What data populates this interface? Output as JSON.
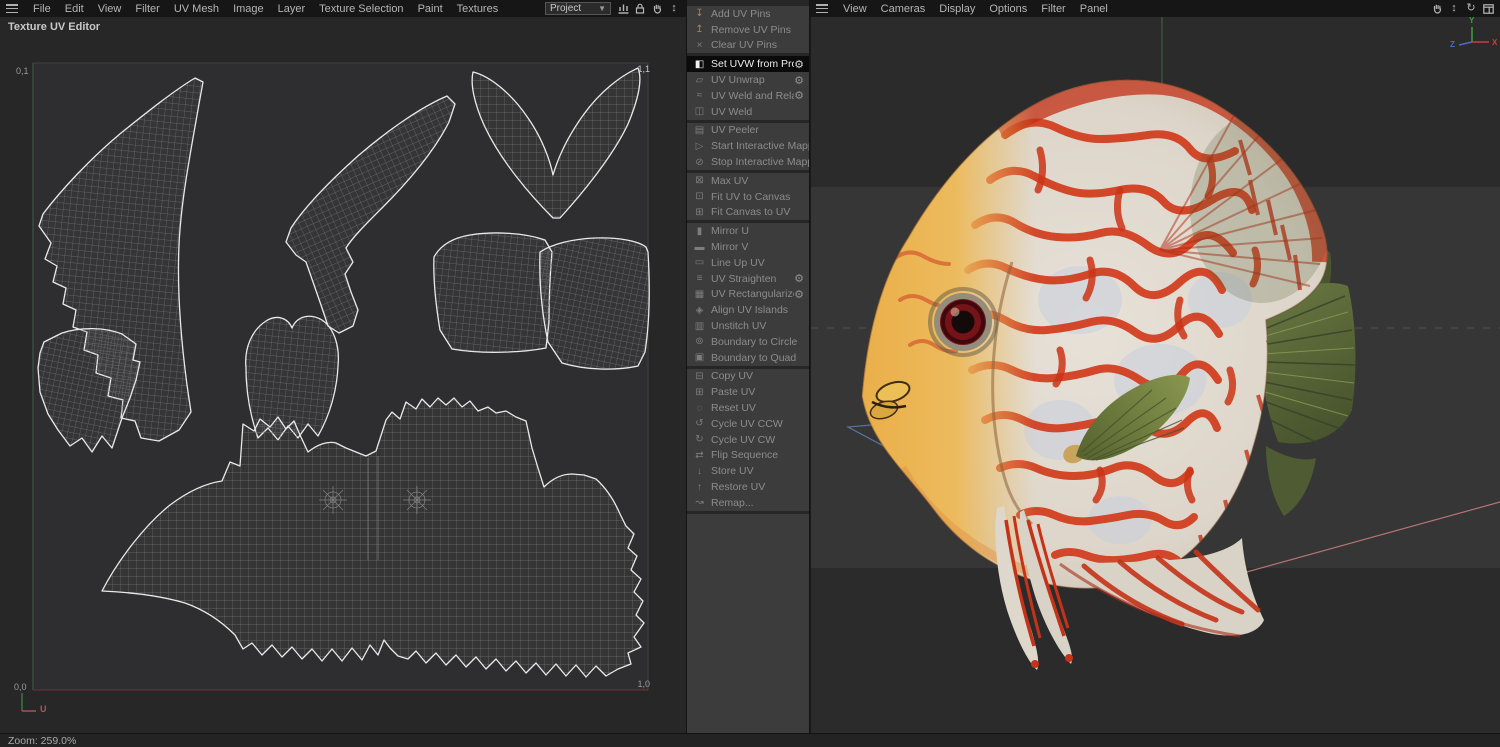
{
  "window": {
    "status_zoom": "Zoom: 259.0%"
  },
  "left_menubar": {
    "items": [
      "File",
      "Edit",
      "View",
      "Filter",
      "UV Mesh",
      "Image",
      "Layer",
      "Texture Selection",
      "Paint",
      "Textures"
    ],
    "project_dropdown": "Project",
    "icons": [
      "histogram-icon",
      "lock-icon",
      "hand-icon",
      "move-vertical-icon"
    ]
  },
  "right_menubar": {
    "items": [
      "View",
      "Cameras",
      "Display",
      "Options",
      "Filter",
      "Panel"
    ],
    "icons": [
      "hand-icon",
      "move-vertical-icon",
      "rotate-icon",
      "panel-icon"
    ]
  },
  "uv_editor": {
    "title": "Texture UV Editor",
    "corner_labels": {
      "top_left": "0,1",
      "top_right": "1,1",
      "bottom_left": "0,0",
      "bottom_right": "1,0"
    },
    "axis_u_label": "U"
  },
  "viewport_gizmo": {
    "x": "X",
    "y": "Y",
    "z": "Z"
  },
  "colors": {
    "axis_x_red": "#c04040",
    "axis_y_green": "#3aa43a",
    "axis_z_blue": "#4a6cc8",
    "uv_u_axis_red": "#b35555",
    "uv_v_axis_green": "#3d7a4d",
    "highlight_row_bg": "#0b0b0b",
    "fish_pattern_red": "#d23b1c",
    "fish_head_yellow": "#eaae48",
    "fin_olive_green": "#6a7a42"
  },
  "command_panel": {
    "gear_glyph": "⚙",
    "groups": [
      {
        "items": [
          {
            "label": "Add UV Pins",
            "glyph": "↧",
            "pin": true,
            "enabled": false
          },
          {
            "label": "Remove UV Pins",
            "glyph": "↥",
            "pin": true,
            "enabled": false
          },
          {
            "label": "Clear UV Pins",
            "glyph": "×",
            "enabled": false
          }
        ]
      },
      {
        "items": [
          {
            "label": "Set UVW from Projection",
            "glyph": "◧",
            "active": true,
            "gear": true,
            "enabled": true
          },
          {
            "label": "UV Unwrap",
            "glyph": "▱",
            "gear": true,
            "enabled": false
          },
          {
            "label": "UV Weld and Relax",
            "glyph": "≈",
            "gear": true,
            "enabled": false
          },
          {
            "label": "UV Weld",
            "glyph": "◫",
            "enabled": false
          }
        ]
      },
      {
        "items": [
          {
            "label": "UV Peeler",
            "glyph": "▤",
            "enabled": false
          },
          {
            "label": "Start Interactive Mapping",
            "glyph": "▷",
            "enabled": false
          },
          {
            "label": "Stop Interactive Mapping",
            "glyph": "⊘",
            "enabled": false
          }
        ]
      },
      {
        "items": [
          {
            "label": "Max UV",
            "glyph": "⊠",
            "enabled": false
          },
          {
            "label": "Fit UV to Canvas",
            "glyph": "⊡",
            "enabled": false
          },
          {
            "label": "Fit Canvas to UV",
            "glyph": "⊞",
            "enabled": false
          }
        ]
      },
      {
        "items": [
          {
            "label": "Mirror U",
            "glyph": "▮",
            "enabled": false
          },
          {
            "label": "Mirror V",
            "glyph": "▬",
            "enabled": false
          },
          {
            "label": "Line Up UV",
            "glyph": "▭",
            "enabled": false
          },
          {
            "label": "UV Straighten",
            "glyph": "≡",
            "gear": true,
            "enabled": false
          },
          {
            "label": "UV Rectangularize",
            "glyph": "▦",
            "gear": true,
            "enabled": false
          },
          {
            "label": "Align UV Islands",
            "glyph": "◈",
            "enabled": false
          },
          {
            "label": "Unstitch UV",
            "glyph": "▥",
            "enabled": false
          },
          {
            "label": "Boundary to Circle",
            "glyph": "⊚",
            "enabled": false
          },
          {
            "label": "Boundary to Quad",
            "glyph": "▣",
            "enabled": false
          }
        ]
      },
      {
        "items": [
          {
            "label": "Copy UV",
            "glyph": "⊟",
            "enabled": false
          },
          {
            "label": "Paste UV",
            "glyph": "⊞",
            "enabled": false
          },
          {
            "label": "Reset UV",
            "glyph": "◌",
            "enabled": false
          },
          {
            "label": "Cycle UV CCW",
            "glyph": "↺",
            "enabled": false
          },
          {
            "label": "Cycle UV CW",
            "glyph": "↻",
            "enabled": false
          },
          {
            "label": "Flip Sequence",
            "glyph": "⇄",
            "enabled": false
          },
          {
            "label": "Store UV",
            "glyph": "↓",
            "enabled": false
          },
          {
            "label": "Restore UV",
            "glyph": "↑",
            "enabled": false
          },
          {
            "label": "Remap...",
            "glyph": "↝",
            "enabled": false
          }
        ]
      }
    ]
  }
}
